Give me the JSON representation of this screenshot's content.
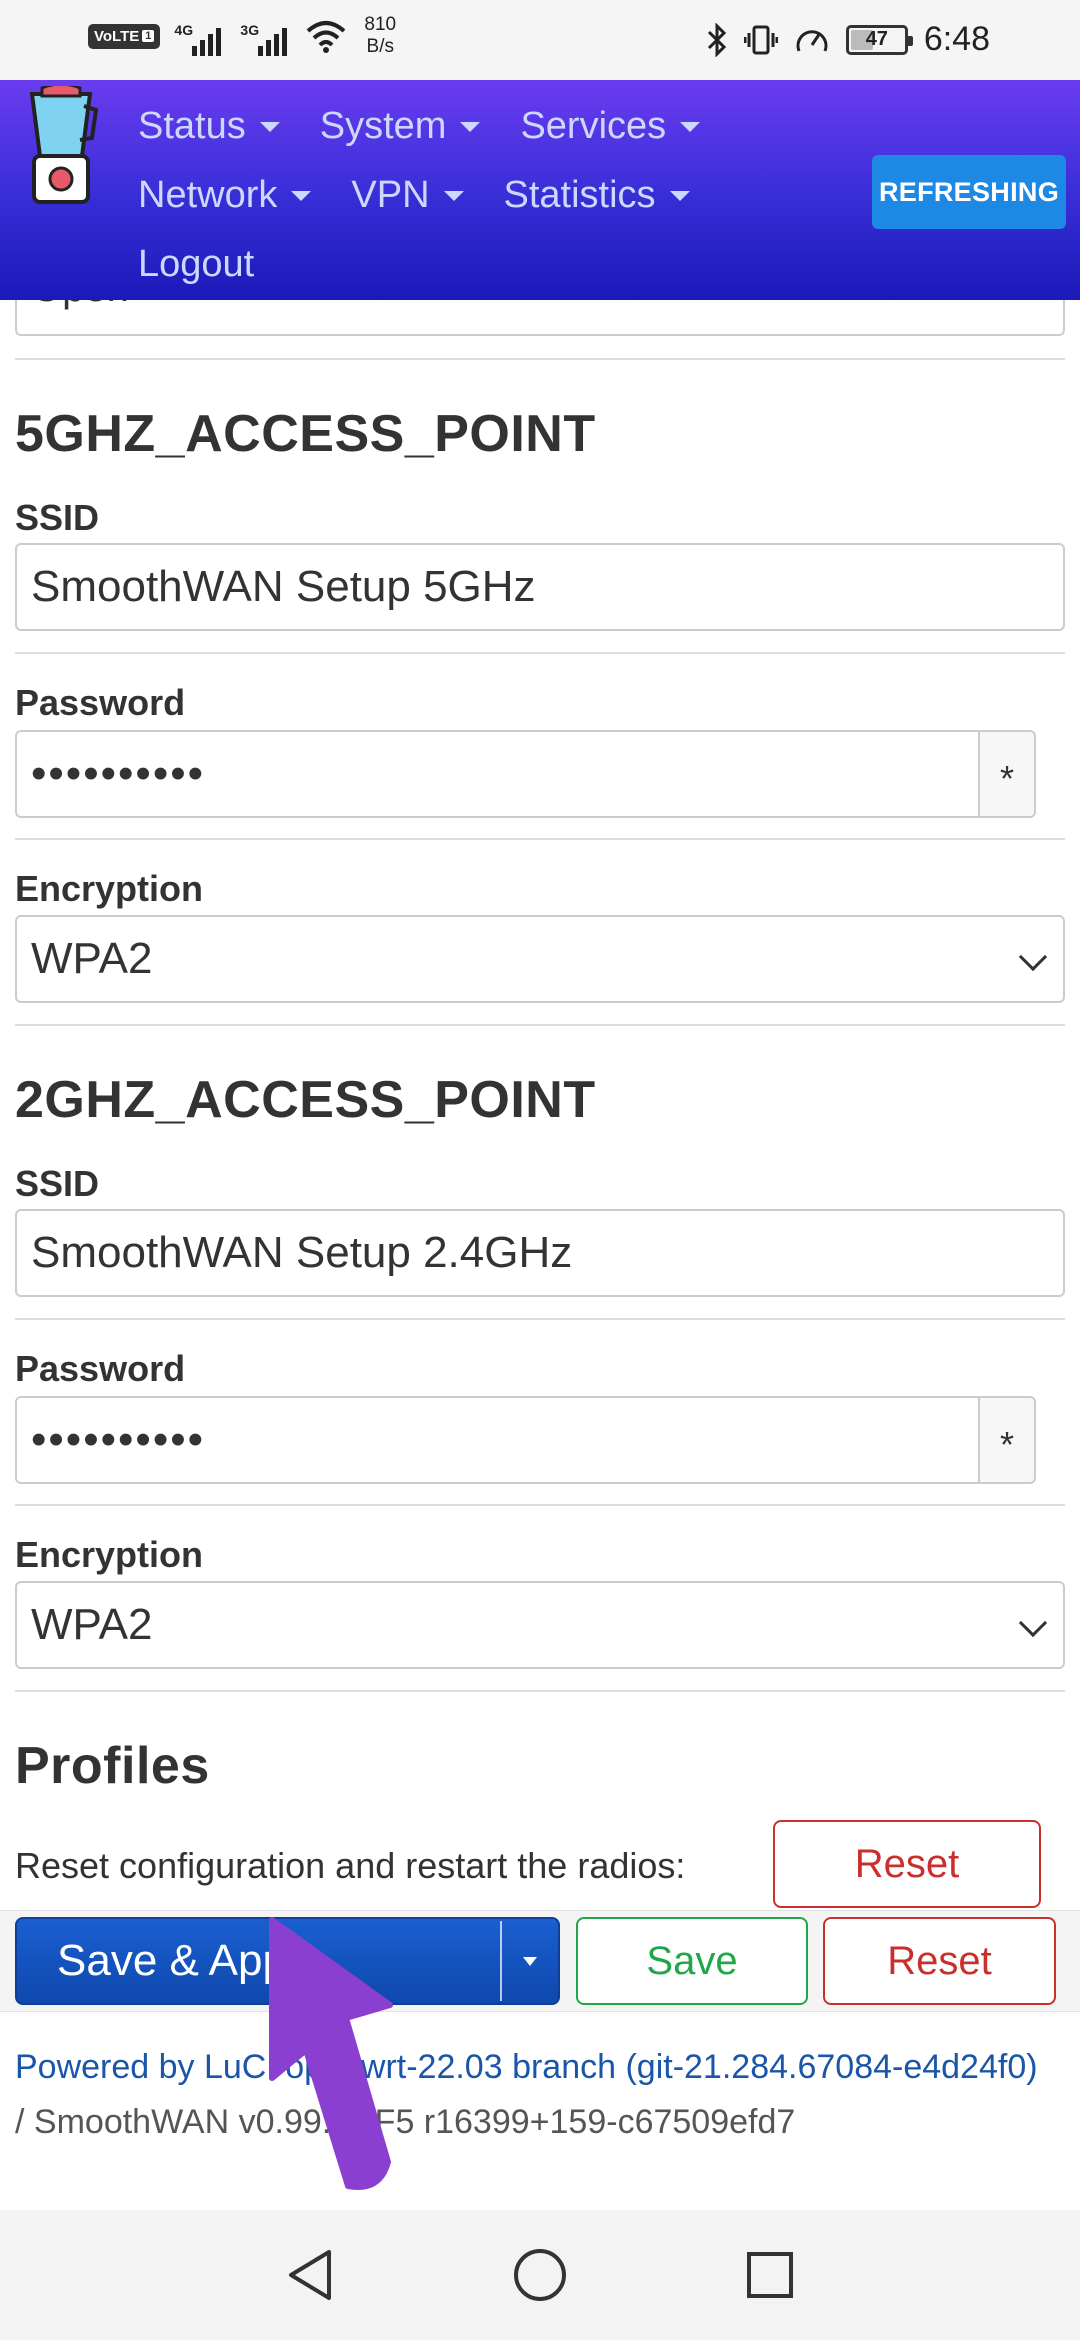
{
  "status_bar": {
    "volte": "VoLTE",
    "volte_sub": "1",
    "signal1_tag": "4G",
    "signal2_tag": "3G",
    "net_speed_value": "810",
    "net_speed_unit": "B/s",
    "battery": "47",
    "battery_level": 0.47,
    "time": "6:48",
    "icons": [
      "bluetooth-icon",
      "vibrate-icon",
      "speed-icon",
      "battery-icon"
    ]
  },
  "header": {
    "nav": [
      [
        "Status",
        "System",
        "Services"
      ],
      [
        "Network",
        "VPN",
        "Statistics"
      ]
    ],
    "logout": "Logout",
    "refresh_label": "REFRESHING"
  },
  "content": {
    "prev_encryption_value": "Open",
    "ap5": {
      "title": "5GHZ_ACCESS_POINT",
      "ssid_label": "SSID",
      "ssid_value": "SmoothWAN Setup 5GHz",
      "password_label": "Password",
      "password_value": "••••••••••",
      "toggle_label": "*",
      "encryption_label": "Encryption",
      "encryption_value": "WPA2"
    },
    "ap2": {
      "title": "2GHZ_ACCESS_POINT",
      "ssid_label": "SSID",
      "ssid_value": "SmoothWAN Setup 2.4GHz",
      "password_label": "Password",
      "password_value": "••••••••••",
      "toggle_label": "*",
      "encryption_label": "Encryption",
      "encryption_value": "WPA2"
    },
    "profiles": {
      "title": "Profiles",
      "description": "Reset configuration and restart the radios:",
      "reset_label": "Reset"
    }
  },
  "actions": {
    "save_apply": "Save & Apply",
    "save": "Save",
    "reset": "Reset"
  },
  "footer": {
    "powered_by_link": "Powered by LuCI openwrt-22.03 branch (git-21.284.67084-e4d24f0)",
    "separator": " / ",
    "version": "SmoothWAN v0.99.5HF5 r16399+159-c67509efd7"
  },
  "colors": {
    "header_top": "#6a3cf0",
    "header_bottom": "#1a1ab8",
    "primary_button": "#1a5fd0",
    "refresh_button": "#1e88e5",
    "danger": "#c9302c",
    "success": "#22a64a",
    "annotation_arrow": "#8a3fd1"
  }
}
